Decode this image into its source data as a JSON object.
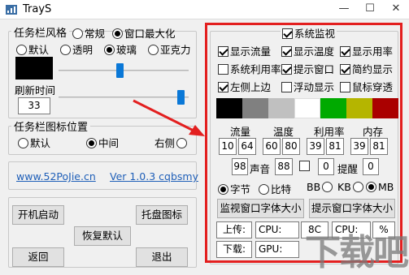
{
  "window": {
    "title": "TrayS",
    "minimize": "—",
    "maximize": "☐",
    "close": "✕"
  },
  "style_group": {
    "legend": "任务栏风格",
    "mode_normal": "常规",
    "mode_max": "窗口最大化",
    "opt_default": "默认",
    "opt_transparent": "透明",
    "opt_glass": "玻璃",
    "opt_acrylic": "亚克力",
    "refresh_label": "刷新时间",
    "refresh_value": "33",
    "slider1_level": 0.47,
    "slider2_level": 0.97
  },
  "position_group": {
    "legend": "任务栏图标位置",
    "opt_default": "默认",
    "opt_center": "中间",
    "opt_right": "右侧"
  },
  "about": {
    "site": "www.52PoJie.cn",
    "version": "Ver 1.0.3 cqbsmy"
  },
  "buttons": {
    "autostart": "开机启动",
    "tray": "托盘图标",
    "restore": "恢复默认",
    "back": "返回",
    "exit": "退出"
  },
  "monitor": {
    "main": "系统监视",
    "show_traffic": "显示流量",
    "show_temp": "显示温度",
    "show_usage": "显示用率",
    "sys_usage": "系统利用率",
    "tip_window": "提示窗口",
    "compact": "简约显示",
    "left_top": "左侧上边",
    "float": "浮动显示",
    "mouse_through": "鼠标穿透",
    "swatches": [
      "#000000",
      "#808080",
      "#c0c0c0",
      "#ffffff",
      "#00aa00",
      "#b5b500",
      "#aa0000"
    ],
    "col_traffic": "流量",
    "col_temp": "温度",
    "col_usage": "利用率",
    "col_mem": "内存",
    "values_row": [
      "10",
      "64",
      "60",
      "80",
      "39",
      "81",
      "39",
      "81"
    ],
    "tip_value": "98",
    "sound_label": "声音",
    "sound_value": "88",
    "remind_small": "0",
    "remind_label": "提醒",
    "remind_value": "0",
    "unit_byte": "字节",
    "unit_bit": "比特",
    "unit_bb": "BB",
    "unit_kb": "KB",
    "unit_mb": "MB",
    "btn_monitor_font": "监视窗口字体大小",
    "btn_tip_font": "提示窗口字体大小",
    "upload_label": "上传:",
    "cpu_label": "CPU:",
    "cpu_value": "8C",
    "cpu2_label": "CPU:",
    "cpu2_value": "%",
    "download_label": "下载:",
    "gpu_label": "GPU:"
  },
  "watermark": "下载吧"
}
